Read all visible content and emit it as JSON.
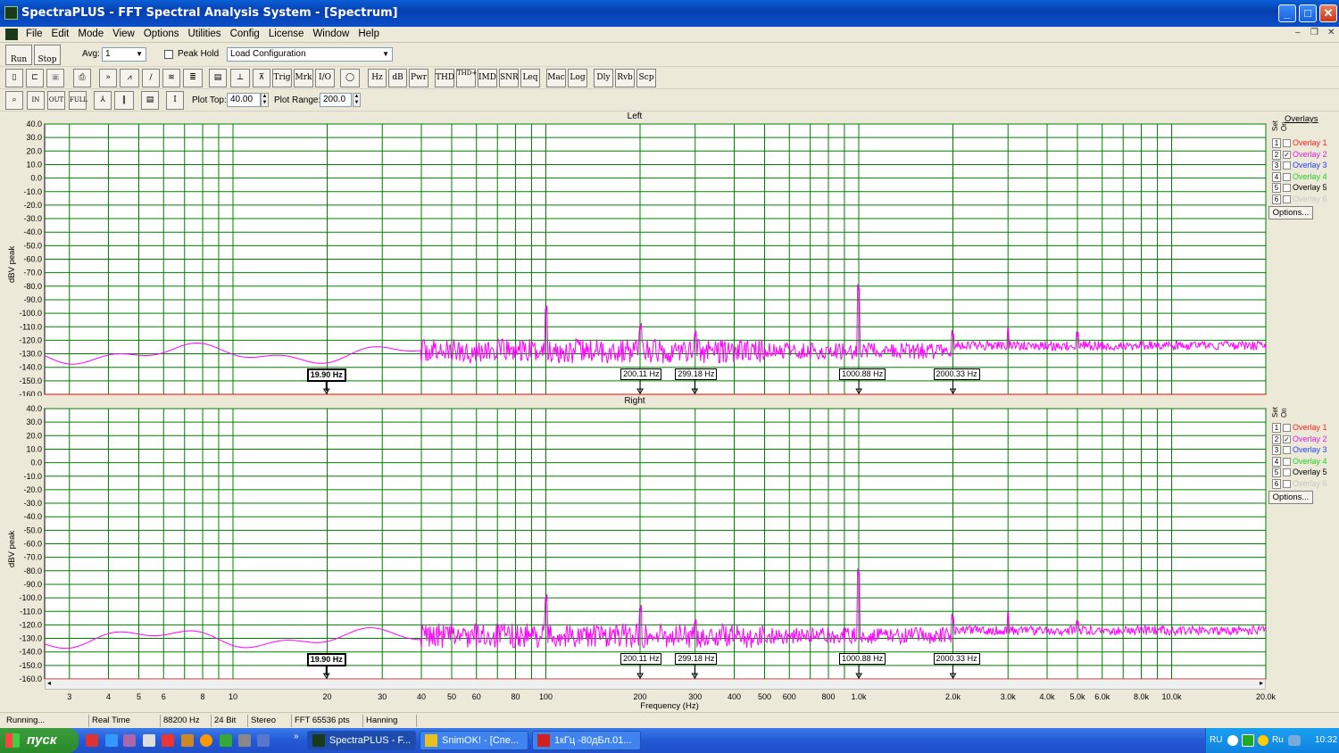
{
  "window": {
    "title": "SpectraPLUS - FFT Spectral Analysis System - [Spectrum]"
  },
  "menu": [
    "File",
    "Edit",
    "Mode",
    "View",
    "Options",
    "Utilities",
    "Config",
    "License",
    "Window",
    "Help"
  ],
  "toolbar1": {
    "run_label": "Run",
    "stop_label": "Stop",
    "avg_label": "Avg:",
    "avg_value": "1",
    "peak_hold_label": "Peak Hold",
    "config_value": "Load Configuration"
  },
  "toolbar2": {
    "buttons": [
      "Trig",
      "Mrk",
      "I/O",
      "Hz",
      "dB",
      "Pwr",
      "THD",
      "THD+N",
      "IMD",
      "SNR",
      "Leq",
      "Mac",
      "Log",
      "Dly",
      "Rvb",
      "Scp"
    ]
  },
  "toolbar3": {
    "plot_top_label": "Plot Top:",
    "plot_top_value": "40.00",
    "plot_range_label": "Plot Range:",
    "plot_range_value": "200.0"
  },
  "plots": [
    {
      "title": "Left",
      "ylabel": "dBV peak"
    },
    {
      "title": "Right",
      "ylabel": "dBV peak"
    }
  ],
  "y_ticks": [
    "40.0",
    "30.0",
    "20.0",
    "10.0",
    "0.0",
    "-10.0",
    "-20.0",
    "-30.0",
    "-40.0",
    "-50.0",
    "-60.0",
    "-70.0",
    "-80.0",
    "-90.0",
    "-100.0",
    "-110.0",
    "-120.0",
    "-130.0",
    "-140.0",
    "-150.0",
    "-160.0"
  ],
  "x_ticks": [
    {
      "f": 3,
      "label": "3"
    },
    {
      "f": 4,
      "label": "4"
    },
    {
      "f": 5,
      "label": "5"
    },
    {
      "f": 6,
      "label": "6"
    },
    {
      "f": 8,
      "label": "8"
    },
    {
      "f": 10,
      "label": "10"
    },
    {
      "f": 20,
      "label": "20"
    },
    {
      "f": 30,
      "label": "30"
    },
    {
      "f": 40,
      "label": "40"
    },
    {
      "f": 50,
      "label": "50"
    },
    {
      "f": 60,
      "label": "60"
    },
    {
      "f": 80,
      "label": "80"
    },
    {
      "f": 100,
      "label": "100"
    },
    {
      "f": 200,
      "label": "200"
    },
    {
      "f": 300,
      "label": "300"
    },
    {
      "f": 400,
      "label": "400"
    },
    {
      "f": 500,
      "label": "500"
    },
    {
      "f": 600,
      "label": "600"
    },
    {
      "f": 800,
      "label": "800"
    },
    {
      "f": 1000,
      "label": "1.0k"
    },
    {
      "f": 2000,
      "label": "2.0k"
    },
    {
      "f": 3000,
      "label": "3.0k"
    },
    {
      "f": 4000,
      "label": "4.0k"
    },
    {
      "f": 5000,
      "label": "5.0k"
    },
    {
      "f": 6000,
      "label": "6.0k"
    },
    {
      "f": 8000,
      "label": "8.0k"
    },
    {
      "f": 10000,
      "label": "10.0k"
    },
    {
      "f": 20000,
      "label": "20.0k"
    }
  ],
  "x_label": "Frequency (Hz)",
  "markers": [
    {
      "f": 19.9,
      "label": "19.90 Hz",
      "selected": true
    },
    {
      "f": 200.11,
      "label": "200.11 Hz",
      "selected": false
    },
    {
      "f": 299.18,
      "label": "299.18 Hz",
      "selected": false
    },
    {
      "f": 1000.88,
      "label": "1000.88 Hz",
      "selected": false
    },
    {
      "f": 2000.33,
      "label": "2000.33 Hz",
      "selected": false
    }
  ],
  "chart_data": [
    {
      "type": "line",
      "title": "Left",
      "ylabel": "dBV peak",
      "xlabel": "Frequency (Hz)",
      "xscale": "log",
      "xlim": [
        2.5,
        20000
      ],
      "ylim": [
        -160,
        40
      ],
      "grid": true,
      "series": [
        {
          "color": "#ff00ff",
          "peaks": [
            {
              "x": 100,
              "y": -100
            },
            {
              "x": 200,
              "y": -113
            },
            {
              "x": 300,
              "y": -118
            },
            {
              "x": 1000,
              "y": -84
            },
            {
              "x": 2000,
              "y": -118
            },
            {
              "x": 3000,
              "y": -113
            },
            {
              "x": 5000,
              "y": -118
            }
          ],
          "baseline_db": -128
        }
      ]
    },
    {
      "type": "line",
      "title": "Right",
      "ylabel": "dBV peak",
      "xlabel": "Frequency (Hz)",
      "xscale": "log",
      "xlim": [
        2.5,
        20000
      ],
      "ylim": [
        -160,
        40
      ],
      "grid": true,
      "series": [
        {
          "color": "#ff00ff",
          "peaks": [
            {
              "x": 100,
              "y": -103
            },
            {
              "x": 200,
              "y": -111
            },
            {
              "x": 300,
              "y": -121
            },
            {
              "x": 1000,
              "y": -84
            },
            {
              "x": 2000,
              "y": -117
            },
            {
              "x": 3000,
              "y": -113
            },
            {
              "x": 5000,
              "y": -121
            }
          ],
          "baseline_db": -128
        }
      ]
    }
  ],
  "overlays": {
    "title": "Overlays",
    "set_label": "Set",
    "on_label": "On",
    "options_label": "Options...",
    "items": [
      {
        "num": "1",
        "label": "Overlay 1",
        "color": "#ff2020",
        "checked": false
      },
      {
        "num": "2",
        "label": "Overlay 2",
        "color": "#e020e0",
        "checked": true
      },
      {
        "num": "3",
        "label": "Overlay 3",
        "color": "#2040ff",
        "checked": false
      },
      {
        "num": "4",
        "label": "Overlay 4",
        "color": "#20d020",
        "checked": false
      },
      {
        "num": "5",
        "label": "Overlay 5",
        "color": "#000000",
        "checked": false
      },
      {
        "num": "6",
        "label": "Overlay 6",
        "color": "#c8c8c8",
        "checked": false
      }
    ]
  },
  "status": [
    "Running...",
    "Real Time",
    "88200 Hz",
    "24 Bit",
    "Stereo",
    "FFT 65536 pts",
    "Hanning"
  ],
  "taskbar": {
    "start_label": "пуск",
    "tasks": [
      {
        "label": "SpectraPLUS - F...",
        "active": true
      },
      {
        "label": "SnimOK! - [Спе...",
        "active": false
      },
      {
        "label": "1кГц -80дБл.01...",
        "active": false
      }
    ],
    "lang": "RU",
    "lang2": "Ru",
    "clock": "10:32"
  }
}
